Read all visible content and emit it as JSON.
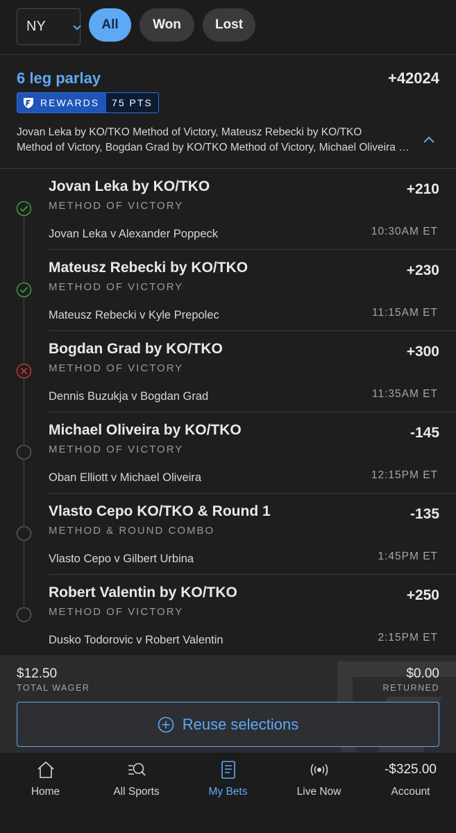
{
  "filters": {
    "state": "NY",
    "tabs": [
      {
        "label": "All",
        "active": true
      },
      {
        "label": "Won",
        "active": false
      },
      {
        "label": "Lost",
        "active": false
      }
    ]
  },
  "bet": {
    "title": "6 leg parlay",
    "odds": "+42024",
    "rewards_label": "REWARDS",
    "rewards_points": "75 PTS",
    "summary_line1": "Jovan Leka by KO/TKO Method of Victory, Mateusz Rebecki by KO/TKO",
    "summary_line2": "Method of Victory, Bogdan Grad by KO/TKO Method of Victory, Michael Oliveira by KO/TKO Method of Victory",
    "legs": [
      {
        "selection": "Jovan Leka by KO/TKO",
        "market": "METHOD OF VICTORY",
        "odds": "+210",
        "event": "Jovan Leka v Alexander Poppeck",
        "time": "10:30AM ET",
        "status": "won"
      },
      {
        "selection": "Mateusz Rebecki by KO/TKO",
        "market": "METHOD OF VICTORY",
        "odds": "+230",
        "event": "Mateusz Rebecki v Kyle Prepolec",
        "time": "11:15AM ET",
        "status": "won"
      },
      {
        "selection": "Bogdan Grad by KO/TKO",
        "market": "METHOD OF VICTORY",
        "odds": "+300",
        "event": "Dennis Buzukja v Bogdan Grad",
        "time": "11:35AM ET",
        "status": "lost"
      },
      {
        "selection": "Michael Oliveira by KO/TKO",
        "market": "METHOD OF VICTORY",
        "odds": "-145",
        "event": "Oban Elliott v Michael Oliveira",
        "time": "12:15PM ET",
        "status": "pending"
      },
      {
        "selection": "Vlasto Cepo KO/TKO & Round 1",
        "market": "METHOD & ROUND COMBO",
        "odds": "-135",
        "event": "Vlasto Cepo v Gilbert Urbina",
        "time": "1:45PM ET",
        "status": "pending"
      },
      {
        "selection": "Robert Valentin by KO/TKO",
        "market": "METHOD OF VICTORY",
        "odds": "+250",
        "event": "Dusko Todorovic v Robert Valentin",
        "time": "2:15PM ET",
        "status": "pending"
      }
    ],
    "total_wager": "$12.50",
    "total_wager_label": "TOTAL WAGER",
    "returned": "$0.00",
    "returned_label": "RETURNED",
    "reuse_label": "Reuse selections"
  },
  "nav": {
    "items": [
      {
        "label": "Home",
        "icon": "home-icon"
      },
      {
        "label": "All Sports",
        "icon": "search-sports-icon"
      },
      {
        "label": "My Bets",
        "icon": "bet-slip-icon",
        "active": true
      },
      {
        "label": "Live Now",
        "icon": "live-broadcast-icon"
      },
      {
        "label": "Account",
        "icon": "account-balance",
        "balance": "-$325.00"
      }
    ]
  },
  "colors": {
    "accent": "#5fa9f4",
    "background": "#1e1e1f",
    "won": "#3e9b3e",
    "lost": "#c0392b"
  }
}
